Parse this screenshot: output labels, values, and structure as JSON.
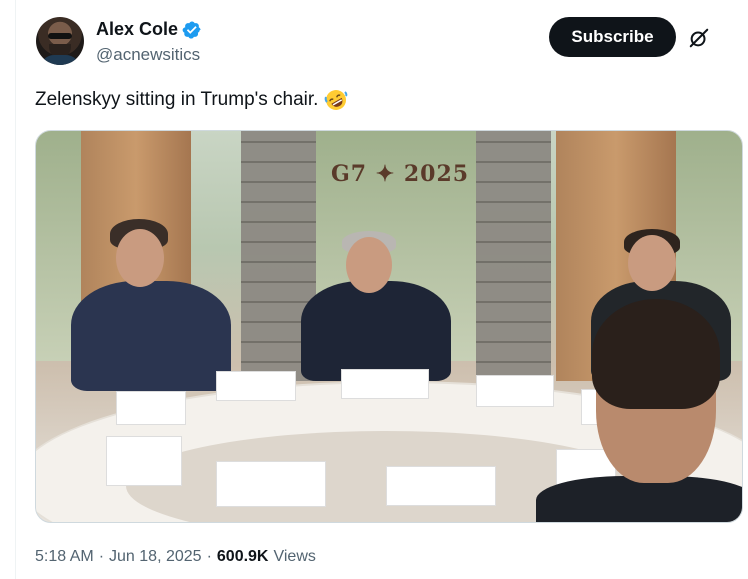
{
  "author": {
    "display_name": "Alex Cole",
    "handle": "@acnewsitics",
    "verified": true,
    "verified_color": "#1d9bf0"
  },
  "header": {
    "subscribe_label": "Subscribe",
    "grok_icon": "grok-icon"
  },
  "tweet": {
    "text": "Zelenskyy sitting in Trump's chair.",
    "emoji": "rolling-on-floor-laughing"
  },
  "media": {
    "backdrop_text": "G7 ✦ 2025"
  },
  "meta": {
    "time": "5:18 AM",
    "separator_1": "·",
    "date": "Jun 18, 2025",
    "separator_2": "·",
    "views_count": "600.9K",
    "views_label": "Views"
  },
  "colors": {
    "text_primary": "#0f1419",
    "text_secondary": "#536471",
    "button_bg": "#0f1419",
    "accent": "#1d9bf0"
  }
}
